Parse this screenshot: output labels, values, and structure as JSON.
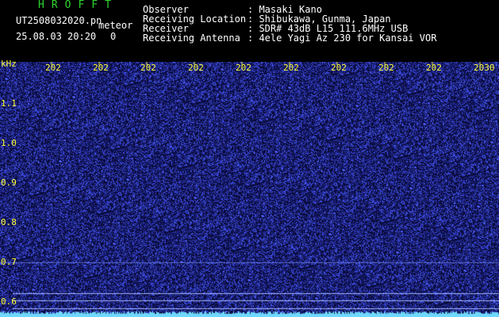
{
  "header": {
    "app_title": "HROFFT",
    "filename": "UT2508032020.pn",
    "meteor_label": "meteor",
    "timestamp": "25.08.03 20:20",
    "meteor_count": "0",
    "info": [
      {
        "label": "Observer",
        "value": ": Masaki Kano"
      },
      {
        "label": "Receiving Location",
        "value": ": Shibukawa, Gunma, Japan"
      },
      {
        "label": "Receiver",
        "value": ": SDR# 43dB L15 111.6MHz USB"
      },
      {
        "label": "Receiving Antenna",
        "value": ": 4ele Yagi Az 230 for Kansai VOR"
      }
    ]
  },
  "plot": {
    "unit_label": "kHz",
    "time_ticks": [
      "202",
      "202",
      "202",
      "202",
      "202",
      "202",
      "202",
      "202",
      "202",
      "2030"
    ],
    "freq_ticks": [
      "1.1",
      "1.0",
      "0.9",
      "0.8",
      "0.7",
      "0.6"
    ],
    "colors": {
      "background": "#0a0c3a",
      "noise": "#3a44d8",
      "carrier": "#6fd8ff",
      "tick_text": "#ffff33",
      "title": "#2fd42f"
    }
  }
}
